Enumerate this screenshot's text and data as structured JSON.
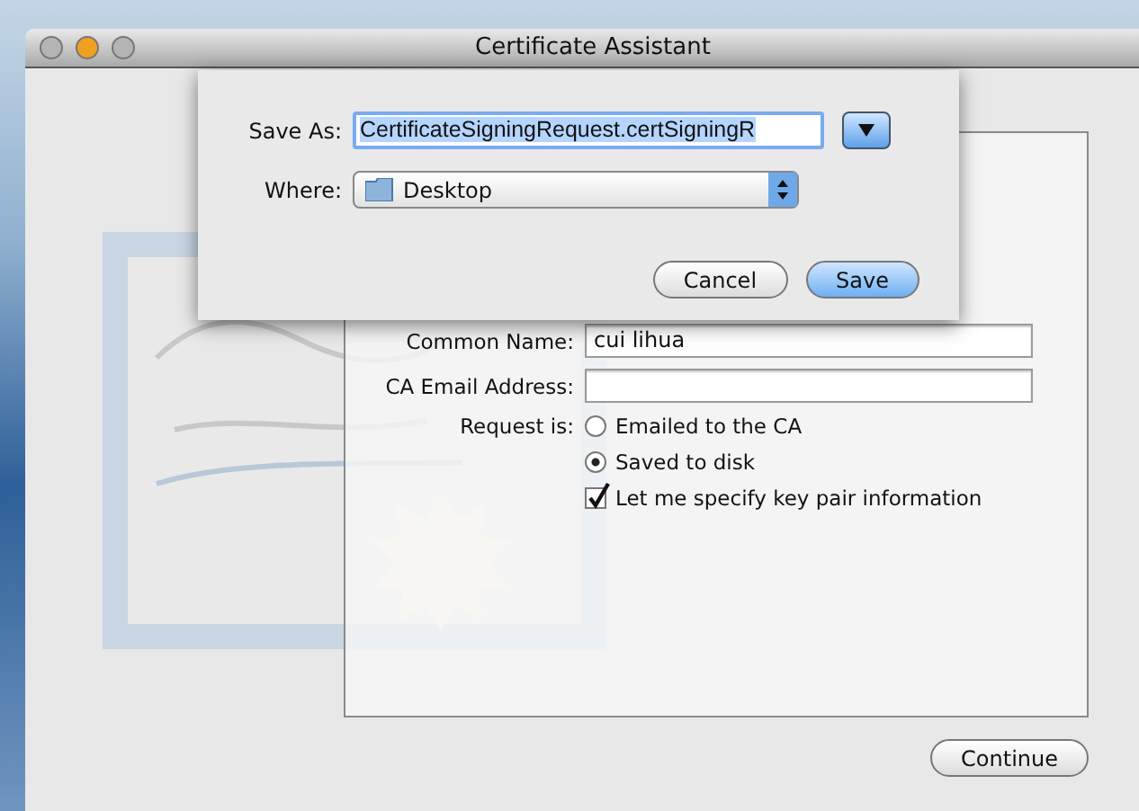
{
  "window": {
    "title": "Certificate Assistant",
    "traffic_lights": [
      {
        "color": "#b4b4b4"
      },
      {
        "color": "#f0a020"
      },
      {
        "color": "#b4b4b4"
      }
    ]
  },
  "save_sheet": {
    "save_as_label": "Save As:",
    "file_name": "CertificateSigningRequest.certSigningR",
    "where_label": "Where:",
    "where_value": "Desktop",
    "buttons": [
      {
        "label": "Cancel",
        "default": false
      },
      {
        "label": "Save",
        "default": true
      }
    ]
  },
  "form": {
    "fields": [
      {
        "label": "Common Name:",
        "value": "cui lihua"
      },
      {
        "label": "CA Email Address:"
      }
    ],
    "request": {
      "label": "Request is:",
      "options": [
        {
          "label": "Emailed to the CA",
          "selected": false
        },
        {
          "label": "Saved to disk",
          "selected": true
        }
      ]
    },
    "key_pair": {
      "label": "Let me specify key pair information",
      "checked": true
    }
  },
  "continue_button": "Continue"
}
